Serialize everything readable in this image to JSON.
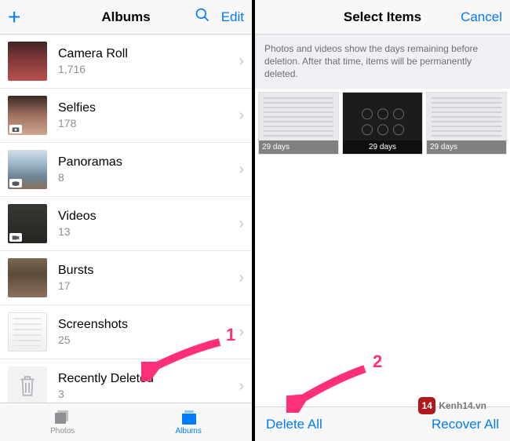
{
  "left": {
    "title": "Albums",
    "edit": "Edit",
    "tabs": {
      "photos": "Photos",
      "albums": "Albums"
    },
    "items": [
      {
        "title": "Camera Roll",
        "count": "1,716"
      },
      {
        "title": "Selfies",
        "count": "178"
      },
      {
        "title": "Panoramas",
        "count": "8"
      },
      {
        "title": "Videos",
        "count": "13"
      },
      {
        "title": "Bursts",
        "count": "17"
      },
      {
        "title": "Screenshots",
        "count": "25"
      },
      {
        "title": "Recently Deleted",
        "count": "3"
      }
    ]
  },
  "right": {
    "title": "Select Items",
    "cancel": "Cancel",
    "info": "Photos and videos show the days remaining before deletion. After that time, items will be permanently deleted.",
    "items": [
      {
        "days": "29 days"
      },
      {
        "days": "29 days"
      },
      {
        "days": "29 days"
      }
    ],
    "deleteAll": "Delete All",
    "recoverAll": "Recover All"
  },
  "annotations": {
    "step1": "1",
    "step2": "2"
  },
  "watermark": {
    "badge": "14",
    "text": "Kenh14.vn"
  }
}
